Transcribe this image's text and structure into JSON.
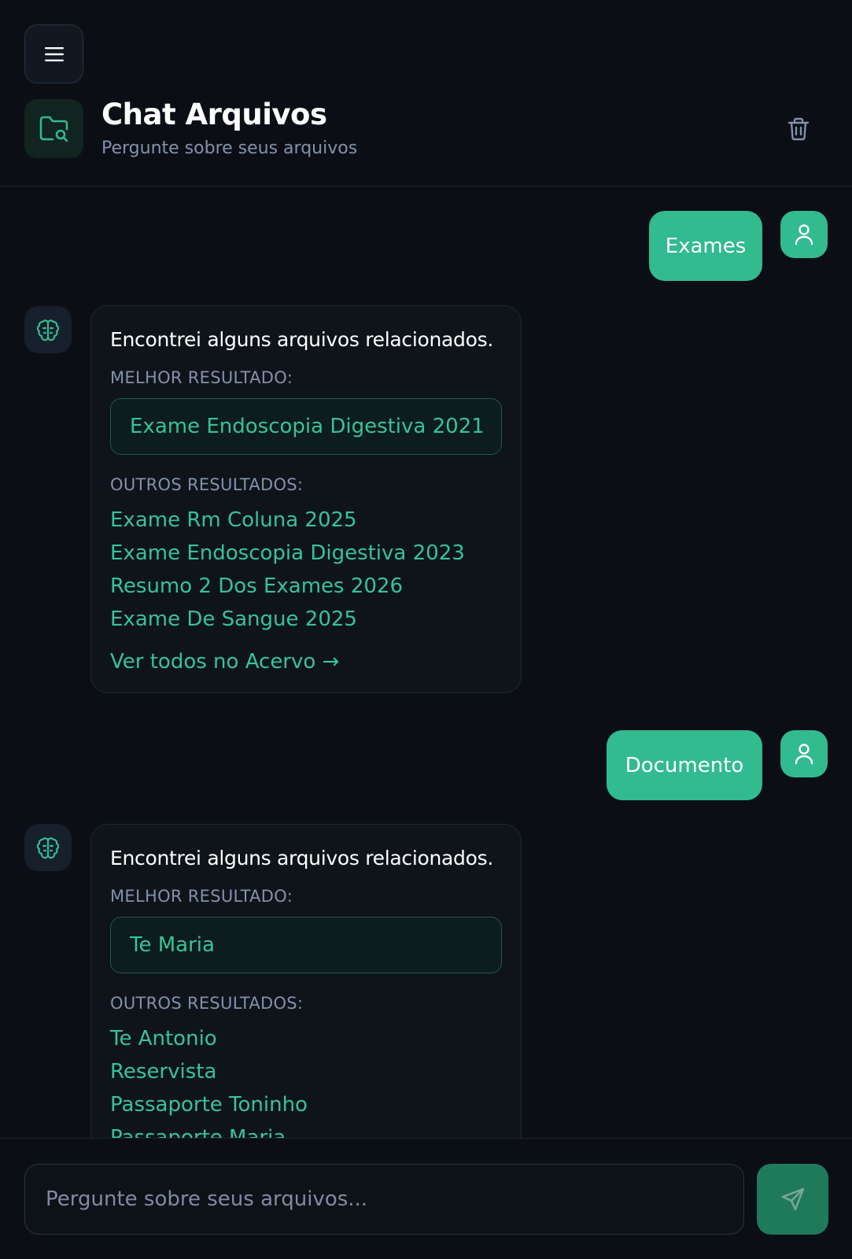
{
  "header": {
    "title": "Chat Arquivos",
    "subtitle": "Pergunte sobre seus arquivos",
    "menu_icon": "menu-icon",
    "app_icon": "folder-search-icon",
    "trash_icon": "trash-icon"
  },
  "colors": {
    "accent": "#31bb8f",
    "background": "#0b0f15",
    "card": "#0f141b",
    "link": "#35c497"
  },
  "messages": [
    {
      "role": "user",
      "text": "Exames"
    },
    {
      "role": "assistant",
      "text": "Encontrei alguns arquivos relacionados.",
      "best_label": "MELHOR RESULTADO:",
      "best": "Exame Endoscopia Digestiva 2021",
      "others_label": "OUTROS RESULTADOS:",
      "others": [
        "Exame Rm Coluna 2025",
        "Exame Endoscopia Digestiva 2023",
        "Resumo 2 Dos Exames 2026",
        "Exame De Sangue 2025"
      ],
      "see_all": "Ver todos no Acervo →"
    },
    {
      "role": "user",
      "text": "Documento"
    },
    {
      "role": "assistant",
      "text": "Encontrei alguns arquivos relacionados.",
      "best_label": "MELHOR RESULTADO:",
      "best": "Te Maria",
      "others_label": "OUTROS RESULTADOS:",
      "others": [
        "Te Antonio",
        "Reservista",
        "Passaporte Toninho",
        "Passaporte Maria"
      ]
    }
  ],
  "composer": {
    "placeholder": "Pergunte sobre seus arquivos...",
    "send_icon": "send-icon"
  }
}
